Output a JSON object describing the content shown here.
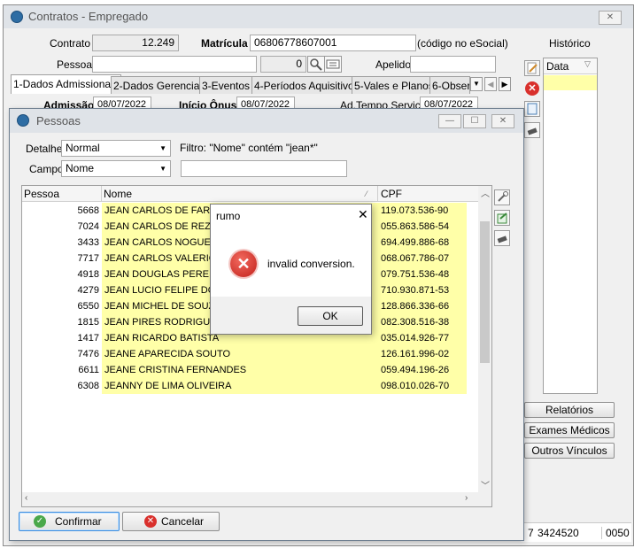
{
  "main": {
    "title": "Contratos - Empregado",
    "contrato_label": "Contrato",
    "contrato_value": "12.249",
    "matricula_label": "Matrícula",
    "matricula_value": "06806778607001",
    "matricula_hint": "(código no eSocial)",
    "pessoa_label": "Pessoa",
    "pessoa_code": "0",
    "apelido_label": "Apelido",
    "historico_label": "Histórico",
    "data_col": "Data",
    "tabs": [
      {
        "label": "1-Dados Admissionais"
      },
      {
        "label": "2-Dados Gerenciais"
      },
      {
        "label": "3-Eventos"
      },
      {
        "label": "4-Períodos Aquisitivos"
      },
      {
        "label": "5-Vales e Planos"
      },
      {
        "label": "6-Observ"
      }
    ],
    "admissao_label": "Admissão",
    "admissao_value": "08/07/2022",
    "inicio_onus_label": "Início Ônus",
    "inicio_onus_value": "08/07/2022",
    "ad_tempo_label": "Ad.Tempo Serviço",
    "ad_tempo_value": "08/07/2022",
    "buttons": {
      "relatorios": "Relatórios",
      "exames": "Exames Médicos",
      "outros": "Outros Vínculos"
    },
    "bottom_values": {
      "v1": "7",
      "v2": "3424520",
      "v3": "0050"
    }
  },
  "pessoas": {
    "title": "Pessoas",
    "detalhe_label": "Detalhe",
    "detalhe_value": "Normal",
    "filtro_text": "Filtro: \"Nome\" contém \"jean*\"",
    "campo_label": "Campo",
    "campo_value": "Nome",
    "columns": [
      "Pessoa",
      "Nome",
      "CPF"
    ],
    "rows": [
      {
        "id": "5668",
        "nome": "JEAN CARLOS DE FARIA",
        "cpf": "119.073.536-90"
      },
      {
        "id": "7024",
        "nome": "JEAN CARLOS DE REZENDE",
        "cpf": "055.863.586-54"
      },
      {
        "id": "3433",
        "nome": "JEAN CARLOS NOGUEIRA",
        "cpf": "694.499.886-68"
      },
      {
        "id": "7717",
        "nome": "JEAN CARLOS VALERIO",
        "cpf": "068.067.786-07"
      },
      {
        "id": "4918",
        "nome": "JEAN DOUGLAS PEREIRA",
        "cpf": "079.751.536-48"
      },
      {
        "id": "4279",
        "nome": "JEAN LUCIO FELIPE DOS",
        "cpf": "710.930.871-53"
      },
      {
        "id": "6550",
        "nome": "JEAN MICHEL DE SOUZA",
        "cpf": "128.866.336-66"
      },
      {
        "id": "1815",
        "nome": "JEAN PIRES RODRIGUES",
        "cpf": "082.308.516-38"
      },
      {
        "id": "1417",
        "nome": "JEAN RICARDO BATISTA",
        "cpf": "035.014.926-77"
      },
      {
        "id": "7476",
        "nome": "JEANE APARECIDA SOUTO",
        "cpf": "126.161.996-02"
      },
      {
        "id": "6611",
        "nome": "JEANE CRISTINA FERNANDES",
        "cpf": "059.494.196-26"
      },
      {
        "id": "6308",
        "nome": "JEANNY DE LIMA OLIVEIRA",
        "cpf": "098.010.026-70"
      }
    ],
    "confirmar": "Confirmar",
    "cancelar": "Cancelar"
  },
  "dialog": {
    "title": "rumo",
    "message": "invalid conversion.",
    "ok": "OK"
  },
  "colors": {
    "accent": "#3c8dde",
    "error": "#d9302c",
    "highlight": "#ffffa8"
  }
}
